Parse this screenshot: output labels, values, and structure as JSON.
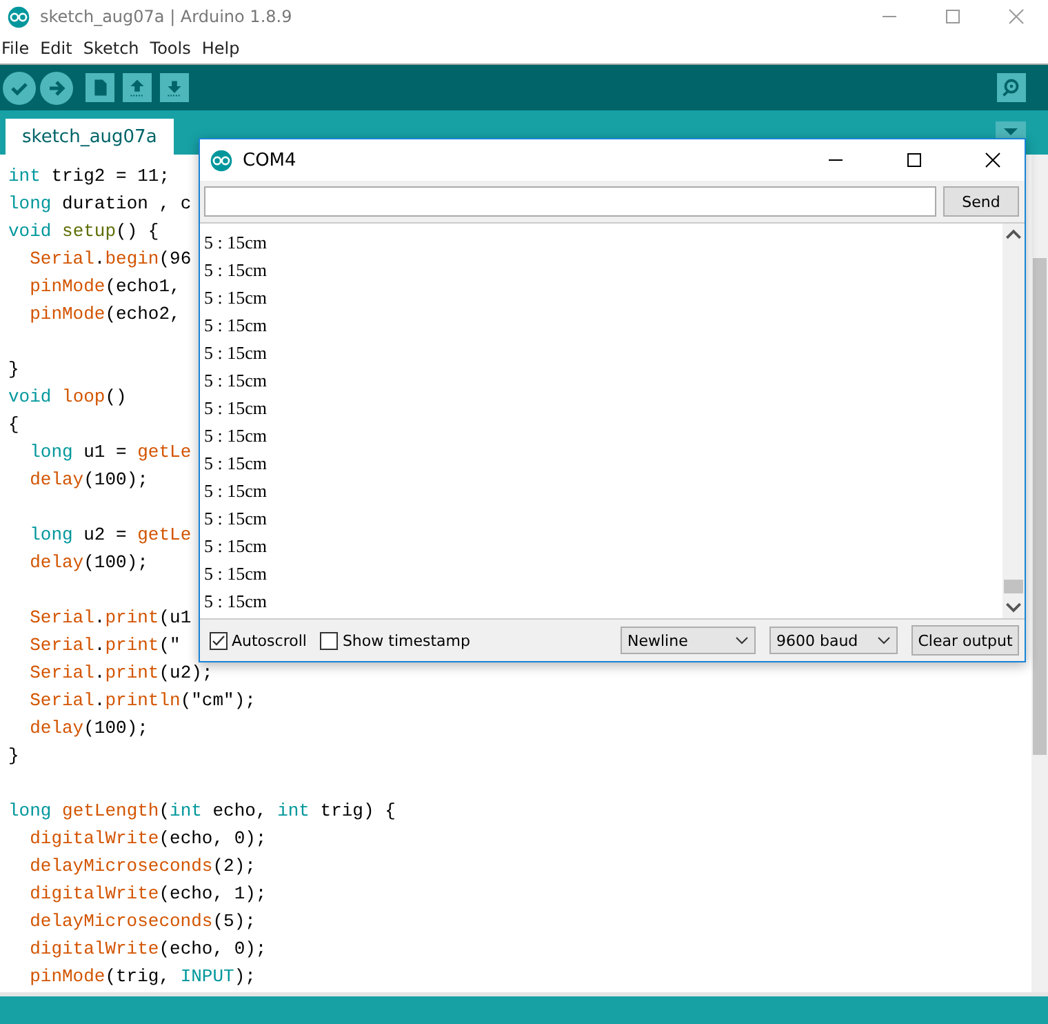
{
  "window": {
    "title": "sketch_aug07a | Arduino 1.8.9"
  },
  "menu": [
    "File",
    "Edit",
    "Sketch",
    "Tools",
    "Help"
  ],
  "tabs": [
    {
      "label": "sketch_aug07a",
      "selected": true
    }
  ],
  "editor": {
    "lines": [
      {
        "indent": false,
        "space_before": false,
        "tokens": [
          {
            "text": "int",
            "kind": "kw"
          },
          {
            "text": " trig2 = 11;",
            "kind": "tx"
          }
        ]
      },
      {
        "indent": false,
        "space_before": false,
        "tokens": [
          {
            "text": "long",
            "kind": "kw"
          },
          {
            "text": " duration , c",
            "kind": "tx"
          }
        ]
      },
      {
        "indent": false,
        "space_before": false,
        "tokens": [
          {
            "text": "void",
            "kind": "kw"
          },
          {
            "text": " setup",
            "kind": "kw3"
          },
          {
            "text": "() {",
            "kind": "tx"
          }
        ]
      },
      {
        "indent": true,
        "space_before": false,
        "tokens": [
          {
            "text": "Serial",
            "kind": "fn"
          },
          {
            "text": ".",
            "kind": "tx"
          },
          {
            "text": "begin",
            "kind": "fn"
          },
          {
            "text": "(96",
            "kind": "tx"
          }
        ]
      },
      {
        "indent": true,
        "space_before": false,
        "tokens": [
          {
            "text": "pinMode",
            "kind": "fn"
          },
          {
            "text": "(echo1,",
            "kind": "tx"
          }
        ]
      },
      {
        "indent": true,
        "space_before": false,
        "tokens": [
          {
            "text": "pinMode",
            "kind": "fn"
          },
          {
            "text": "(echo2,",
            "kind": "tx"
          }
        ]
      },
      {
        "indent": false,
        "space_before": true,
        "tokens": [
          {
            "text": "}",
            "kind": "tx"
          }
        ]
      },
      {
        "indent": false,
        "space_before": false,
        "tokens": [
          {
            "text": "void",
            "kind": "kw"
          },
          {
            "text": " loop",
            "kind": "fn"
          },
          {
            "text": "()",
            "kind": "tx"
          }
        ]
      },
      {
        "indent": false,
        "space_before": false,
        "tokens": [
          {
            "text": "{",
            "kind": "tx"
          }
        ]
      },
      {
        "indent": true,
        "space_before": false,
        "tokens": [
          {
            "text": "long",
            "kind": "kw"
          },
          {
            "text": " u1 = ",
            "kind": "tx"
          },
          {
            "text": "getLe",
            "kind": "fn"
          }
        ]
      },
      {
        "indent": true,
        "space_before": false,
        "tokens": [
          {
            "text": "delay",
            "kind": "fn"
          },
          {
            "text": "(100);",
            "kind": "tx"
          }
        ]
      },
      {
        "indent": true,
        "space_before": true,
        "tokens": [
          {
            "text": "long",
            "kind": "kw"
          },
          {
            "text": " u2 = ",
            "kind": "tx"
          },
          {
            "text": "getLe",
            "kind": "fn"
          }
        ]
      },
      {
        "indent": true,
        "space_before": false,
        "tokens": [
          {
            "text": "delay",
            "kind": "fn"
          },
          {
            "text": "(100);",
            "kind": "tx"
          }
        ]
      },
      {
        "indent": true,
        "space_before": true,
        "tokens": [
          {
            "text": "Serial",
            "kind": "fn"
          },
          {
            "text": ".",
            "kind": "tx"
          },
          {
            "text": "print",
            "kind": "fn"
          },
          {
            "text": "(u1",
            "kind": "tx"
          }
        ]
      },
      {
        "indent": true,
        "space_before": false,
        "tokens": [
          {
            "text": "Serial",
            "kind": "fn"
          },
          {
            "text": ".",
            "kind": "tx"
          },
          {
            "text": "print",
            "kind": "fn"
          },
          {
            "text": "(\"",
            "kind": "tx"
          }
        ]
      },
      {
        "indent": true,
        "space_before": false,
        "tokens": [
          {
            "text": "Serial",
            "kind": "fn"
          },
          {
            "text": ".",
            "kind": "tx"
          },
          {
            "text": "print",
            "kind": "fn"
          },
          {
            "text": "(u2);",
            "kind": "tx"
          }
        ]
      },
      {
        "indent": true,
        "space_before": false,
        "tokens": [
          {
            "text": "Serial",
            "kind": "fn"
          },
          {
            "text": ".",
            "kind": "tx"
          },
          {
            "text": "println",
            "kind": "fn"
          },
          {
            "text": "(\"cm\");",
            "kind": "tx"
          }
        ]
      },
      {
        "indent": true,
        "space_before": false,
        "tokens": [
          {
            "text": "delay",
            "kind": "fn"
          },
          {
            "text": "(100);",
            "kind": "tx"
          }
        ]
      },
      {
        "indent": false,
        "space_before": false,
        "tokens": [
          {
            "text": "}",
            "kind": "tx"
          }
        ]
      },
      {
        "indent": false,
        "space_before": true,
        "tokens": [
          {
            "text": "long",
            "kind": "kw"
          },
          {
            "text": " getLength",
            "kind": "fn"
          },
          {
            "text": "(",
            "kind": "tx"
          },
          {
            "text": "int",
            "kind": "kw"
          },
          {
            "text": " echo, ",
            "kind": "tx"
          },
          {
            "text": "int",
            "kind": "kw"
          },
          {
            "text": " trig) {",
            "kind": "tx"
          }
        ]
      },
      {
        "indent": true,
        "space_before": false,
        "tokens": [
          {
            "text": "digitalWrite",
            "kind": "fn"
          },
          {
            "text": "(echo, 0);",
            "kind": "tx"
          }
        ]
      },
      {
        "indent": true,
        "space_before": false,
        "tokens": [
          {
            "text": "delayMicroseconds",
            "kind": "fn"
          },
          {
            "text": "(2);",
            "kind": "tx"
          }
        ]
      },
      {
        "indent": true,
        "space_before": false,
        "tokens": [
          {
            "text": "digitalWrite",
            "kind": "fn"
          },
          {
            "text": "(echo, 1);",
            "kind": "tx"
          }
        ]
      },
      {
        "indent": true,
        "space_before": false,
        "tokens": [
          {
            "text": "delayMicroseconds",
            "kind": "fn"
          },
          {
            "text": "(5);",
            "kind": "tx"
          }
        ]
      },
      {
        "indent": true,
        "space_before": false,
        "tokens": [
          {
            "text": "digitalWrite",
            "kind": "fn"
          },
          {
            "text": "(echo, 0);",
            "kind": "tx"
          }
        ]
      },
      {
        "indent": true,
        "space_before": false,
        "tokens": [
          {
            "text": "pinMode",
            "kind": "fn"
          },
          {
            "text": "(trig, ",
            "kind": "tx"
          },
          {
            "text": "INPUT",
            "kind": "kw"
          },
          {
            "text": ");",
            "kind": "tx"
          }
        ]
      }
    ]
  },
  "serial_monitor": {
    "title": "COM4",
    "send_button": "Send",
    "output": [
      "5 : 15cm",
      "5 : 15cm",
      "5 : 15cm",
      "5 : 15cm",
      "5 : 15cm",
      "5 : 15cm",
      "5 : 15cm",
      "5 : 15cm",
      "5 : 15cm",
      "5 : 15cm",
      "5 : 15cm",
      "5 : 15cm",
      "5 : 15cm",
      "5 : 15cm"
    ],
    "checkboxes": [
      {
        "label": "Autoscroll",
        "checked": true
      },
      {
        "label": "Show timestamp",
        "checked": false
      }
    ],
    "line_ending": "Newline",
    "baud_rate": "9600 baud",
    "clear_button": "Clear output"
  }
}
